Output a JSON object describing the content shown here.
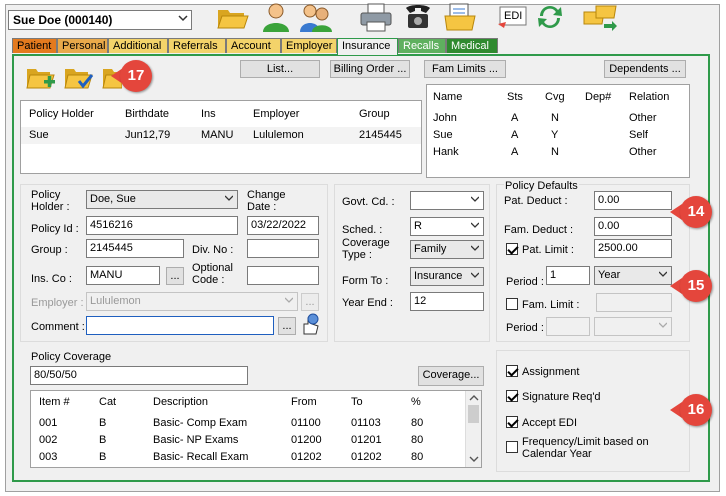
{
  "header": {
    "patient_selector": "Sue Doe (000140)",
    "edi_label": "EDI"
  },
  "tabs": [
    {
      "label": "Patient",
      "color": "#e47a1e"
    },
    {
      "label": "Personal",
      "color": "#e9a94a"
    },
    {
      "label": "Additional",
      "color": "#f3d36a"
    },
    {
      "label": "Referrals",
      "color": "#f3d36a"
    },
    {
      "label": "Account",
      "color": "#f3d36a"
    },
    {
      "label": "Employer",
      "color": "#f3d36a"
    },
    {
      "label": "Insurance",
      "color": "#f0f0f0"
    },
    {
      "label": "Recalls",
      "color": "#5fb05f"
    },
    {
      "label": "Medical",
      "color": "#2f8a2f"
    }
  ],
  "buttons": {
    "list": "List...",
    "billing_order": "Billing Order ...",
    "fam_limits": "Fam Limits ...",
    "dependents": "Dependents ...",
    "coverage": "Coverage...",
    "ellipsis": "..."
  },
  "policy_table": {
    "headers": [
      "Policy Holder",
      "Birthdate",
      "Ins",
      "Employer",
      "Group"
    ],
    "rows": [
      [
        "Sue",
        "Jun12,79",
        "MANU",
        "Lululemon",
        "2145445"
      ]
    ]
  },
  "family_table": {
    "headers": [
      "Name",
      "Sts",
      "Cvg",
      "Dep#",
      "Relation"
    ],
    "rows": [
      [
        "John",
        "A",
        "N",
        "",
        "Other"
      ],
      [
        "Sue",
        "A",
        "Y",
        "",
        "Self"
      ],
      [
        "Hank",
        "A",
        "N",
        "",
        "Other"
      ]
    ]
  },
  "policy_form": {
    "holder_label": "Policy Holder :",
    "holder_value": "Doe, Sue",
    "change_date_label": "Change Date :",
    "change_date_value": "03/22/2022",
    "policy_id_label": "Policy Id :",
    "policy_id_value": "4516216",
    "group_label": "Group :",
    "group_value": "2145445",
    "div_no_label": "Div. No :",
    "div_no_value": "",
    "ins_co_label": "Ins. Co :",
    "ins_co_value": "MANU",
    "optional_code_label": "Optional Code :",
    "optional_code_value": "",
    "employer_label": "Employer :",
    "employer_value": "Lululemon",
    "comment_label": "Comment :",
    "comment_value": ""
  },
  "govt_form": {
    "govt_cd_label": "Govt. Cd. :",
    "govt_cd_value": "",
    "sched_label": "Sched. :",
    "sched_value": "R",
    "coverage_type_label": "Coverage Type :",
    "coverage_type_value": "Family",
    "form_to_label": "Form To :",
    "form_to_value": "Insurance",
    "year_end_label": "Year End :",
    "year_end_value": "12"
  },
  "defaults": {
    "title": "Policy Defaults",
    "pat_deduct_label": "Pat. Deduct :",
    "pat_deduct_value": "0.00",
    "fam_deduct_label": "Fam. Deduct :",
    "fam_deduct_value": "0.00",
    "pat_limit_label": "Pat. Limit :",
    "pat_limit_value": "2500.00",
    "pat_limit_checked": true,
    "period_label": "Period :",
    "period_value": "1",
    "period_unit": "Year",
    "fam_limit_label": "Fam. Limit :",
    "fam_limit_checked": false,
    "period2_label": "Period :"
  },
  "coverage": {
    "label": "Policy Coverage",
    "value": "80/50/50",
    "headers": [
      "Item #",
      "Cat",
      "Description",
      "From",
      "To",
      "%"
    ],
    "rows": [
      [
        "001",
        "B",
        "Basic- Comp Exam",
        "01100",
        "01103",
        "80"
      ],
      [
        "002",
        "B",
        "Basic- NP Exams",
        "01200",
        "01201",
        "80"
      ],
      [
        "003",
        "B",
        "Basic- Recall Exam",
        "01202",
        "01202",
        "80"
      ]
    ]
  },
  "options": {
    "assignment": "Assignment",
    "signature": "Signature Req'd",
    "accept_edi": "Accept EDI",
    "frequency": "Frequency/Limit based on Calendar Year"
  },
  "callouts": {
    "c17": "17",
    "c14": "14",
    "c15": "15",
    "c16": "16",
    "color": "#e4463c"
  }
}
